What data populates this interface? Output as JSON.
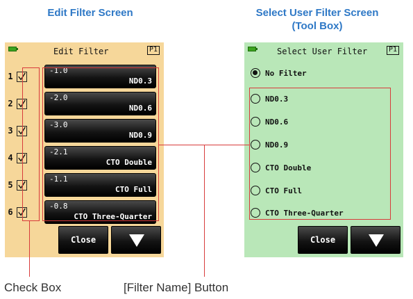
{
  "headings": {
    "left": "Edit Filter Screen",
    "right_line1": "Select User Filter Screen",
    "right_line2": "(Tool Box)"
  },
  "edit_filter": {
    "title": "Edit Filter",
    "page_badge": "P1",
    "battery_icon": "battery-icon",
    "rows": [
      {
        "num": "1",
        "checked": true,
        "value": "-1.0",
        "name": "ND0.3"
      },
      {
        "num": "2",
        "checked": true,
        "value": "-2.0",
        "name": "ND0.6"
      },
      {
        "num": "3",
        "checked": true,
        "value": "-3.0",
        "name": "ND0.9"
      },
      {
        "num": "4",
        "checked": true,
        "value": "-2.1",
        "name": "CTO Double"
      },
      {
        "num": "5",
        "checked": true,
        "value": "-1.1",
        "name": "CTO Full"
      },
      {
        "num": "6",
        "checked": true,
        "value": "-0.8",
        "name": "CTO Three-Quarter"
      }
    ],
    "close_label": "Close",
    "down_icon": "down-arrow-icon"
  },
  "select_user_filter": {
    "title": "Select User Filter",
    "page_badge": "P1",
    "battery_icon": "battery-icon",
    "options": [
      {
        "label": "No Filter",
        "selected": true
      },
      {
        "label": "ND0.3",
        "selected": false
      },
      {
        "label": "ND0.6",
        "selected": false
      },
      {
        "label": "ND0.9",
        "selected": false
      },
      {
        "label": "CTO Double",
        "selected": false
      },
      {
        "label": "CTO Full",
        "selected": false
      },
      {
        "label": "CTO Three-Quarter",
        "selected": false
      }
    ],
    "close_label": "Close",
    "down_icon": "down-arrow-icon"
  },
  "captions": {
    "check_box": "Check Box",
    "filter_name_button": "[Filter Name] Button"
  },
  "colors": {
    "heading": "#2e78c6",
    "edit_bg": "#f6d79a",
    "select_bg": "#b9e7b8",
    "highlight": "#d83b3b",
    "button": "#141414"
  }
}
